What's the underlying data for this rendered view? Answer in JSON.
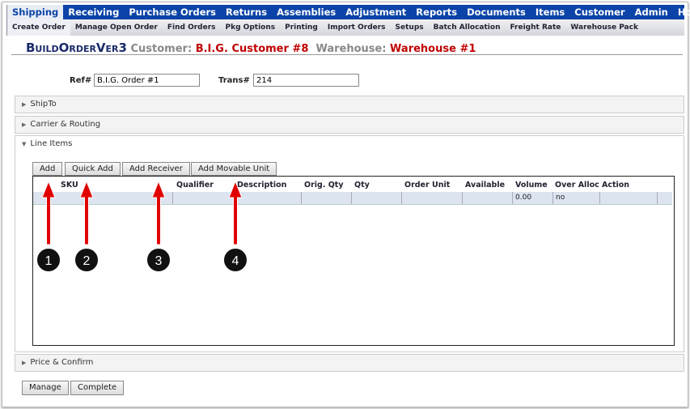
{
  "nav": {
    "tabs": [
      "Shipping",
      "Receiving",
      "Purchase Orders",
      "Returns",
      "Assemblies",
      "Adjustment",
      "Reports",
      "Documents",
      "Items",
      "Customer",
      "Admin",
      "Home"
    ],
    "active": "Shipping"
  },
  "subnav": {
    "tabs": [
      "Create Order",
      "Manage Open Order",
      "Find Orders",
      "Pkg Options",
      "Printing",
      "Import Orders",
      "Setups",
      "Batch Allocation",
      "Freight Rate",
      "Warehouse Pack"
    ],
    "active": "Create Order"
  },
  "header": {
    "page": "BuildOrderVer3",
    "customer_label": "Customer:",
    "customer": "B.I.G. Customer #8",
    "warehouse_label": "Warehouse:",
    "warehouse": "Warehouse #1"
  },
  "form": {
    "ref_label": "Ref#",
    "ref_value": "B.I.G. Order #1",
    "trans_label": "Trans#",
    "trans_value": "214"
  },
  "panels": {
    "shipto": "ShipTo",
    "carrier": "Carrier & Routing",
    "line_items": "Line Items",
    "price": "Price & Confirm"
  },
  "line_items": {
    "buttons": [
      "Add",
      "Quick Add",
      "Add Receiver",
      "Add Movable Unit"
    ],
    "columns": [
      "SKU",
      "Qualifier",
      "Description",
      "Orig. Qty",
      "Qty",
      "Order Unit",
      "Available",
      "Volume",
      "Over Alloc",
      "Action"
    ],
    "rows": [
      {
        "volume": "0.00",
        "over_alloc": "no"
      }
    ]
  },
  "footer": {
    "manage": "Manage",
    "complete": "Complete"
  },
  "annotations": {
    "labels": [
      "1",
      "2",
      "3",
      "4"
    ],
    "arrow_color": "#e00000",
    "circle_color": "#111111"
  }
}
